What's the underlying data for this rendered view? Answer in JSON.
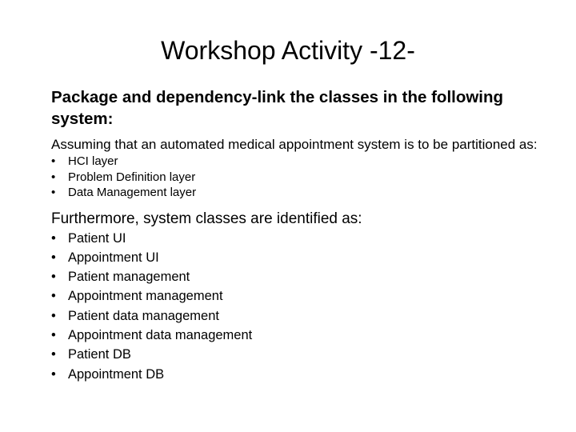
{
  "slide": {
    "title": "Workshop Activity -12-",
    "lead_bold": "Package and dependency-link the classes in the following system:",
    "paragraph": "Assuming that an automated medical appointment system is to be partitioned as:",
    "layers": [
      {
        "bullet": "•",
        "label": "HCI layer"
      },
      {
        "bullet": "•",
        "label": "Problem Definition layer"
      },
      {
        "bullet": "•",
        "label": "Data Management layer"
      }
    ],
    "section_lead": "Furthermore, system classes are identified as:",
    "classes": [
      {
        "bullet": "•",
        "label": "Patient UI"
      },
      {
        "bullet": "•",
        "label": "Appointment UI"
      },
      {
        "bullet": "•",
        "label": "Patient management"
      },
      {
        "bullet": "•",
        "label": "Appointment management"
      },
      {
        "bullet": "•",
        "label": "Patient data management"
      },
      {
        "bullet": "•",
        "label": "Appointment data management"
      },
      {
        "bullet": "•",
        "label": "Patient DB"
      },
      {
        "bullet": "•",
        "label": "Appointment DB"
      }
    ]
  },
  "colors": {
    "background": "#ffffff",
    "text": "#000000"
  }
}
